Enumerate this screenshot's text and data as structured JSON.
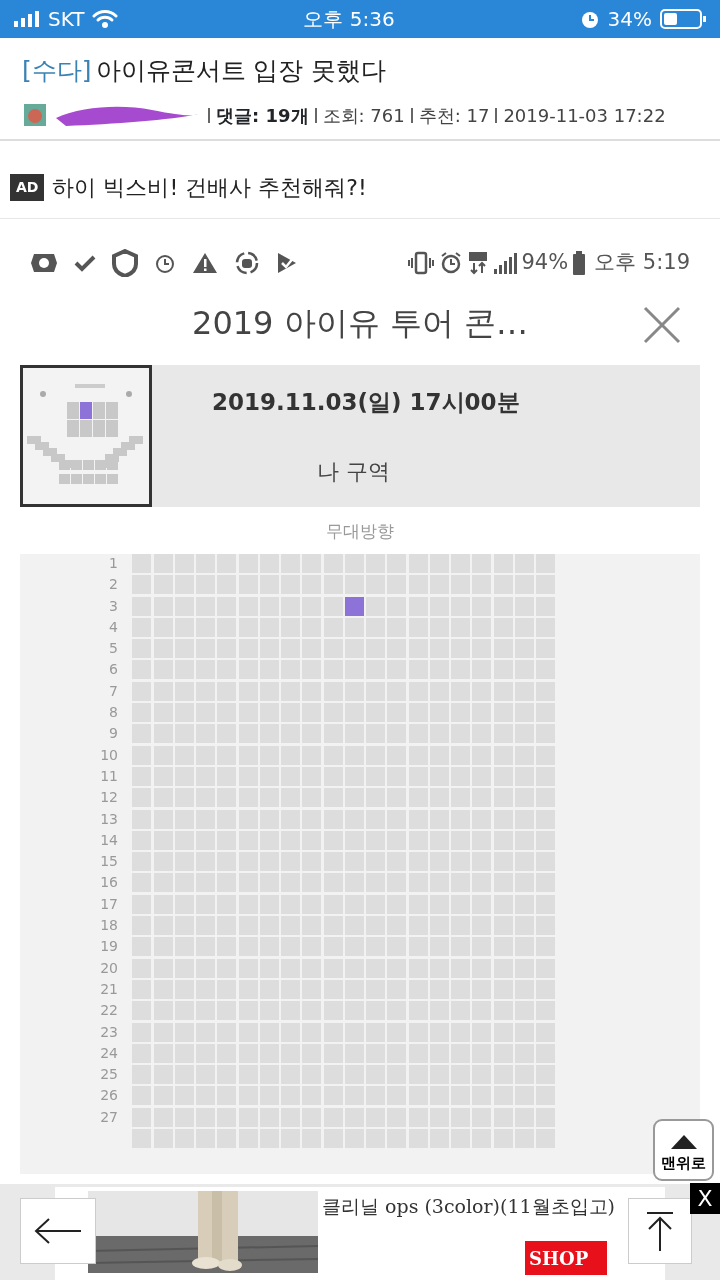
{
  "status_bar": {
    "carrier": "SKT",
    "time": "오후 5:36",
    "battery": "34%"
  },
  "post": {
    "category": "[수다]",
    "title": "아이유콘서트 입장 못했다",
    "meta": [
      {
        "text": "댓글: 19개",
        "emphasized": true
      },
      {
        "text": "조회: 761",
        "emphasized": false
      },
      {
        "text": "추천: 17",
        "emphasized": false
      },
      {
        "text": "2019-11-03 17:22",
        "emphasized": false
      }
    ]
  },
  "ad": {
    "tag": "AD",
    "text": "하이 빅스비! 건배사 추천해줘?!"
  },
  "screenshot": {
    "status_bar": {
      "battery": "94%",
      "time": "오후 5:19"
    },
    "title": "2019 아이유 투어 콘…",
    "date": "2019.11.03(일) 17시00분",
    "section": "나 구역",
    "stage_label": "무대방향",
    "seat_rows": [
      {
        "label": "1",
        "seats": [
          false,
          false,
          false,
          false,
          false,
          false,
          false,
          false,
          false,
          false,
          false,
          false,
          false,
          false,
          false,
          false,
          false,
          false,
          false,
          false
        ]
      },
      {
        "label": "2",
        "seats": [
          false,
          false,
          false,
          false,
          false,
          false,
          false,
          false,
          false,
          false,
          false,
          false,
          false,
          false,
          false,
          false,
          false,
          false,
          false,
          false
        ]
      },
      {
        "label": "3",
        "seats": [
          false,
          false,
          false,
          false,
          false,
          false,
          false,
          false,
          false,
          false,
          true,
          false,
          false,
          false,
          false,
          false,
          false,
          false,
          false,
          false
        ]
      },
      {
        "label": "4",
        "seats": [
          false,
          false,
          false,
          false,
          false,
          false,
          false,
          false,
          false,
          false,
          false,
          false,
          false,
          false,
          false,
          false,
          false,
          false,
          false,
          false
        ]
      },
      {
        "label": "5",
        "seats": [
          false,
          false,
          false,
          false,
          false,
          false,
          false,
          false,
          false,
          false,
          false,
          false,
          false,
          false,
          false,
          false,
          false,
          false,
          false,
          false
        ]
      },
      {
        "label": "6",
        "seats": [
          false,
          false,
          false,
          false,
          false,
          false,
          false,
          false,
          false,
          false,
          false,
          false,
          false,
          false,
          false,
          false,
          false,
          false,
          false,
          false
        ]
      },
      {
        "label": "7",
        "seats": [
          false,
          false,
          false,
          false,
          false,
          false,
          false,
          false,
          false,
          false,
          false,
          false,
          false,
          false,
          false,
          false,
          false,
          false,
          false,
          false
        ]
      },
      {
        "label": "8",
        "seats": [
          false,
          false,
          false,
          false,
          false,
          false,
          false,
          false,
          false,
          false,
          false,
          false,
          false,
          false,
          false,
          false,
          false,
          false,
          false,
          false
        ]
      },
      {
        "label": "9",
        "seats": [
          false,
          false,
          false,
          false,
          false,
          false,
          false,
          false,
          false,
          false,
          false,
          false,
          false,
          false,
          false,
          false,
          false,
          false,
          false,
          false
        ]
      },
      {
        "label": "10",
        "seats": [
          false,
          false,
          false,
          false,
          false,
          false,
          false,
          false,
          false,
          false,
          false,
          false,
          false,
          false,
          false,
          false,
          false,
          false,
          false,
          false
        ]
      },
      {
        "label": "11",
        "seats": [
          false,
          false,
          false,
          false,
          false,
          false,
          false,
          false,
          false,
          false,
          false,
          false,
          false,
          false,
          false,
          false,
          false,
          false,
          false,
          false
        ]
      },
      {
        "label": "12",
        "seats": [
          false,
          false,
          false,
          false,
          false,
          false,
          false,
          false,
          false,
          false,
          false,
          false,
          false,
          false,
          false,
          false,
          false,
          false,
          false,
          false
        ]
      },
      {
        "label": "13",
        "seats": [
          false,
          false,
          false,
          false,
          false,
          false,
          false,
          false,
          false,
          false,
          false,
          false,
          false,
          false,
          false,
          false,
          false,
          false,
          false,
          false
        ]
      },
      {
        "label": "14",
        "seats": [
          false,
          false,
          false,
          false,
          false,
          false,
          false,
          false,
          false,
          false,
          false,
          false,
          false,
          false,
          false,
          false,
          false,
          false,
          false,
          false
        ]
      },
      {
        "label": "15",
        "seats": [
          false,
          false,
          false,
          false,
          false,
          false,
          false,
          false,
          false,
          false,
          false,
          false,
          false,
          false,
          false,
          false,
          false,
          false,
          false,
          false
        ]
      },
      {
        "label": "16",
        "seats": [
          false,
          false,
          false,
          false,
          false,
          false,
          false,
          false,
          false,
          false,
          false,
          false,
          false,
          false,
          false,
          false,
          false,
          false,
          false,
          false
        ]
      },
      {
        "label": "17",
        "seats": [
          false,
          false,
          false,
          false,
          false,
          false,
          false,
          false,
          false,
          false,
          false,
          false,
          false,
          false,
          false,
          false,
          false,
          false,
          false,
          false
        ]
      },
      {
        "label": "18",
        "seats": [
          false,
          false,
          false,
          false,
          false,
          false,
          false,
          false,
          false,
          false,
          false,
          false,
          false,
          false,
          false,
          false,
          false,
          false,
          false,
          false
        ]
      },
      {
        "label": "19",
        "seats": [
          false,
          false,
          false,
          false,
          false,
          false,
          false,
          false,
          false,
          false,
          false,
          false,
          false,
          false,
          false,
          false,
          false,
          false,
          false,
          false
        ]
      },
      {
        "label": "20",
        "seats": [
          false,
          false,
          false,
          false,
          false,
          false,
          false,
          false,
          false,
          false,
          false,
          false,
          false,
          false,
          false,
          false,
          false,
          false,
          false,
          false
        ]
      },
      {
        "label": "21",
        "seats": [
          false,
          false,
          false,
          false,
          false,
          false,
          false,
          false,
          false,
          false,
          false,
          false,
          false,
          false,
          false,
          false,
          false,
          false,
          false,
          false
        ]
      },
      {
        "label": "22",
        "seats": [
          false,
          false,
          false,
          false,
          false,
          false,
          false,
          false,
          false,
          false,
          false,
          false,
          false,
          false,
          false,
          false,
          false,
          false,
          false,
          false
        ]
      },
      {
        "label": "23",
        "seats": [
          false,
          false,
          false,
          false,
          false,
          false,
          false,
          false,
          false,
          false,
          false,
          false,
          false,
          false,
          false,
          false,
          false,
          false,
          false,
          false
        ]
      },
      {
        "label": "24",
        "seats": [
          false,
          false,
          false,
          false,
          false,
          false,
          false,
          false,
          false,
          false,
          false,
          false,
          false,
          false,
          false,
          false,
          false,
          false,
          false,
          false
        ]
      },
      {
        "label": "25",
        "seats": [
          false,
          false,
          false,
          false,
          false,
          false,
          false,
          false,
          false,
          false,
          false,
          false,
          false,
          false,
          false,
          false,
          false,
          false,
          false,
          false
        ]
      },
      {
        "label": "26",
        "seats": [
          false,
          false,
          false,
          false,
          false,
          false,
          false,
          false,
          false,
          false,
          false,
          false,
          false,
          false,
          false,
          false,
          false,
          false,
          false,
          false
        ]
      },
      {
        "label": "27",
        "seats": [
          false,
          false,
          false,
          false,
          false,
          false,
          false,
          false,
          false,
          false,
          false,
          false,
          false,
          false,
          false,
          false,
          false,
          false,
          false,
          false
        ]
      }
    ]
  },
  "top_button": {
    "label": "맨위로"
  },
  "bottom_ad": {
    "text": "클리닐 ops (3color)(11월초입고)",
    "button": "SHOP",
    "close": "X"
  }
}
